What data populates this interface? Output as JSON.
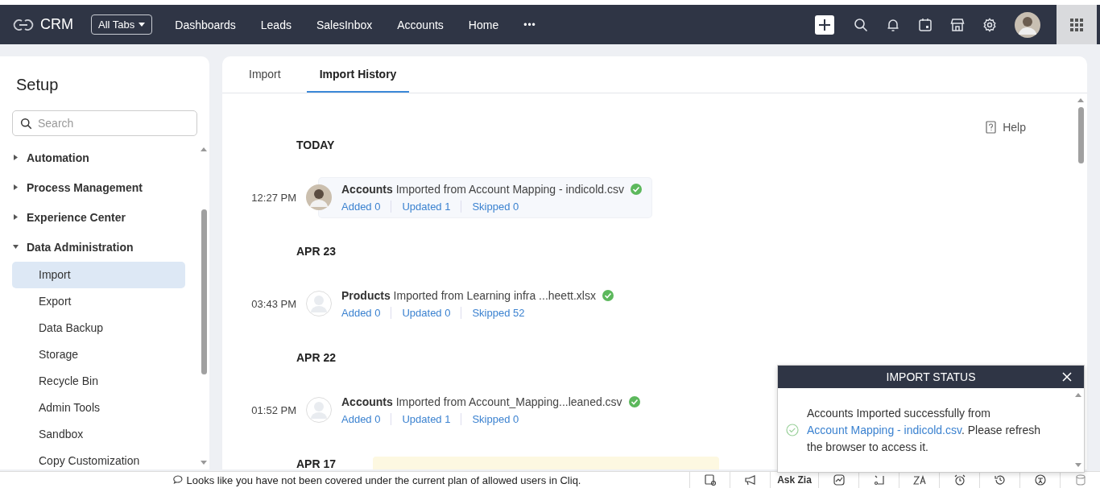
{
  "topbar": {
    "app_name": "CRM",
    "all_tabs_label": "All Tabs",
    "nav": [
      "Dashboards",
      "Leads",
      "SalesInbox",
      "Accounts",
      "Home"
    ],
    "more": "•••"
  },
  "sidebar": {
    "title": "Setup",
    "search_placeholder": "Search",
    "items": [
      {
        "label": "Automation",
        "expanded": false
      },
      {
        "label": "Process Management",
        "expanded": false
      },
      {
        "label": "Experience Center",
        "expanded": false
      },
      {
        "label": "Data Administration",
        "expanded": true,
        "children": [
          {
            "label": "Import",
            "selected": true
          },
          {
            "label": "Export",
            "selected": false
          },
          {
            "label": "Data Backup",
            "selected": false
          },
          {
            "label": "Storage",
            "selected": false
          },
          {
            "label": "Recycle Bin",
            "selected": false
          },
          {
            "label": "Admin Tools",
            "selected": false
          },
          {
            "label": "Sandbox",
            "selected": false
          },
          {
            "label": "Copy Customization",
            "selected": false
          }
        ]
      }
    ]
  },
  "main": {
    "tabs": [
      {
        "label": "Import",
        "selected": false
      },
      {
        "label": "Import History",
        "selected": true
      }
    ],
    "help_label": "Help",
    "groups": [
      {
        "date": "TODAY",
        "entries": [
          {
            "time": "12:27 PM",
            "has_photo": true,
            "module": "Accounts",
            "description": "Imported from Account Mapping - indicold.csv",
            "highlighted": true,
            "stats": [
              "Added 0",
              "Updated 1",
              "Skipped 0"
            ]
          }
        ]
      },
      {
        "date": "APR 23",
        "entries": [
          {
            "time": "03:43 PM",
            "has_photo": false,
            "module": "Products",
            "description": "Imported from Learning infra ...heett.xlsx",
            "highlighted": false,
            "stats": [
              "Added 0",
              "Updated 0",
              "Skipped 52"
            ]
          }
        ]
      },
      {
        "date": "APR 22",
        "entries": [
          {
            "time": "01:52 PM",
            "has_photo": false,
            "module": "Accounts",
            "description": "Imported from Account_Mapping...leaned.csv",
            "highlighted": false,
            "stats": [
              "Added 0",
              "Updated 1",
              "Skipped 0"
            ]
          }
        ]
      },
      {
        "date": "APR 17",
        "note": true
      }
    ]
  },
  "toast": {
    "title": "IMPORT STATUS",
    "message_start": "Accounts Imported successfully from ",
    "link": "Account Mapping - indicold.csv",
    "message_end": ". Please refresh the browser to access it."
  },
  "bottom_bar": {
    "message": "Looks like you have not been covered under the current plan of allowed users in Cliq.",
    "ask_zia": "Ask Zia"
  }
}
